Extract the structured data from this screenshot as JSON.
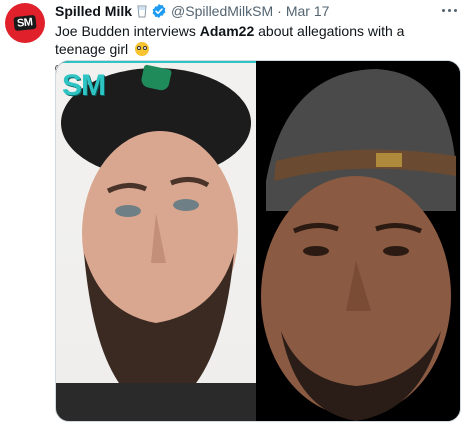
{
  "tweet": {
    "display_name": "Spilled Milk",
    "handle": "@SpilledMilkSM",
    "separator": "·",
    "date": "Mar 17",
    "text_before": "Joe Budden interviews ",
    "text_bold": "Adam22",
    "text_after": " about allegations with a teenage girl",
    "avatar_text": "SM",
    "watermark": "SM"
  },
  "colors": {
    "accent": "#1d9bf0",
    "avatar_bg": "#e0202a",
    "watermark": "#2ec4c4"
  },
  "icons": {
    "verified": "verified-badge-icon",
    "cup": "milk-cup-icon",
    "more": "more-icon"
  }
}
